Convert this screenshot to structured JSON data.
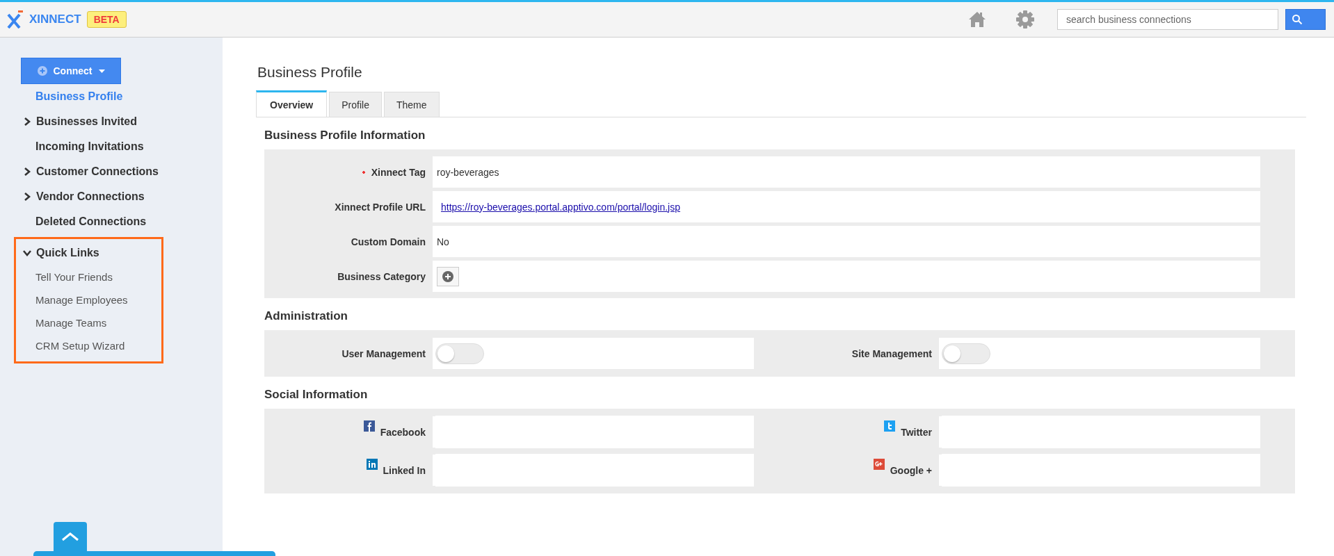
{
  "header": {
    "logo_text": "XINNECT",
    "badge": "BETA",
    "search": {
      "placeholder": "search business connections"
    }
  },
  "sidebar": {
    "connect_button": "Connect",
    "items": [
      {
        "label": "Business Profile",
        "kind": "link",
        "selected": true
      },
      {
        "label": "Businesses Invited",
        "kind": "group",
        "expanded": false,
        "selected": false
      },
      {
        "label": "Incoming Invitations",
        "kind": "link",
        "selected": false
      },
      {
        "label": "Customer Connections",
        "kind": "group",
        "expanded": false,
        "selected": false
      },
      {
        "label": "Vendor Connections",
        "kind": "group",
        "expanded": false,
        "selected": false
      },
      {
        "label": "Deleted Connections",
        "kind": "link",
        "selected": false
      },
      {
        "label": "Quick Links",
        "kind": "group",
        "expanded": true,
        "selected": false,
        "highlighted": true,
        "children": [
          {
            "label": "Tell Your Friends",
            "selected": false
          },
          {
            "label": "Manage Employees",
            "selected": false
          },
          {
            "label": "Manage Teams",
            "selected": false
          },
          {
            "label": "CRM Setup Wizard",
            "selected": false
          }
        ]
      }
    ]
  },
  "page_title": "Business Profile",
  "tabs": [
    {
      "label": "Overview",
      "selected": true
    },
    {
      "label": "Profile",
      "selected": false
    },
    {
      "label": "Theme",
      "selected": false
    }
  ],
  "profile_section": {
    "title": "Business Profile Information",
    "rows": [
      {
        "label": "Xinnect Tag",
        "required": true,
        "kind": "text",
        "value": "roy-beverages"
      },
      {
        "label": "Xinnect Profile URL",
        "required": false,
        "kind": "link",
        "value": "https://roy-beverages.portal.apptivo.com/portal/login.jsp"
      },
      {
        "label": "Custom Domain",
        "required": false,
        "kind": "text",
        "value": "No"
      },
      {
        "label": "Business Category",
        "required": false,
        "kind": "add"
      }
    ]
  },
  "administration": {
    "title": "Administration",
    "toggles": [
      {
        "label": "User Management",
        "on": false
      },
      {
        "label": "Site Management",
        "on": false
      }
    ]
  },
  "social": {
    "title": "Social Information",
    "fields": [
      {
        "label": "Facebook",
        "kind": "facebook"
      },
      {
        "label": "Twitter",
        "kind": "twitter"
      },
      {
        "label": "Linked In",
        "kind": "linkedin"
      },
      {
        "label": "Google +",
        "kind": "google"
      }
    ]
  }
}
